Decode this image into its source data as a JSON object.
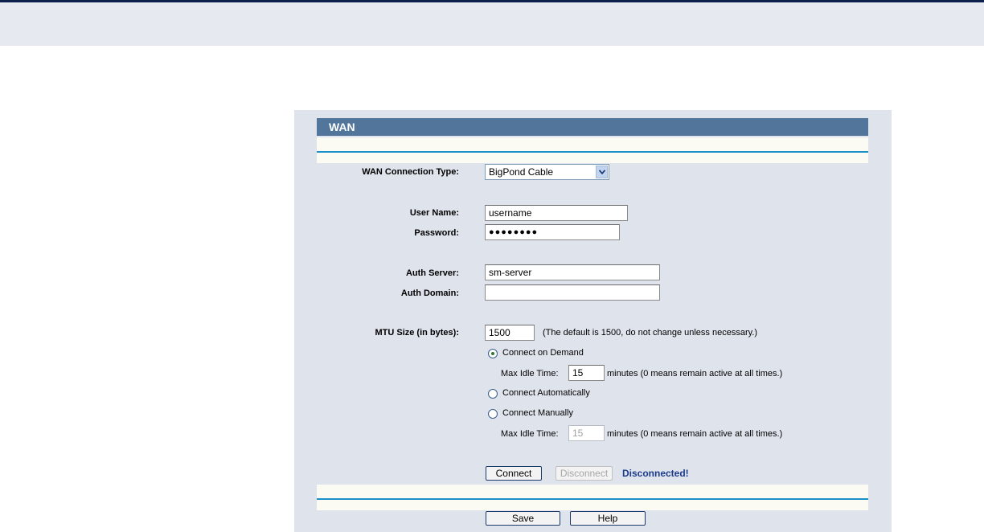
{
  "page": {
    "title": "WAN"
  },
  "form": {
    "connection_type_label": "WAN Connection Type:",
    "connection_type_value": "BigPond Cable",
    "username_label": "User Name:",
    "username_value": "username",
    "password_label": "Password:",
    "password_value": "●●●●●●●●",
    "auth_server_label": "Auth Server:",
    "auth_server_value": "sm-server",
    "auth_domain_label": "Auth Domain:",
    "auth_domain_value": "",
    "mtu_label": "MTU Size (in bytes):",
    "mtu_value": "1500",
    "mtu_note": "(The default is 1500, do not change unless necessary.)",
    "connect_on_demand": "Connect on Demand",
    "max_idle_label": "Max Idle Time:",
    "max_idle_value_1": "15",
    "max_idle_value_2": "15",
    "idle_note": "minutes (0 means remain active at all times.)",
    "connect_automatically": "Connect Automatically",
    "connect_manually": "Connect Manually",
    "selected_mode": "Connect on Demand"
  },
  "actions": {
    "connect": "Connect",
    "disconnect": "Disconnect",
    "status": "Disconnected!",
    "save": "Save",
    "help": "Help"
  }
}
